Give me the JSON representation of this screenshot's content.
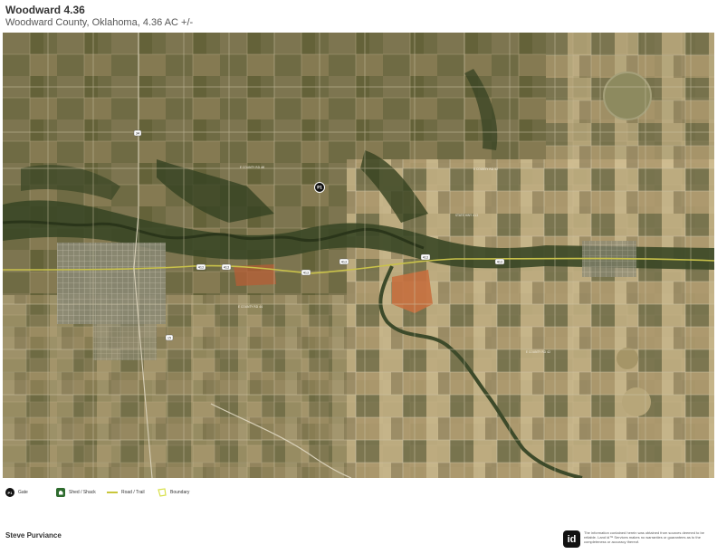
{
  "header": {
    "title": "Woodward 4.36",
    "subtitle": "Woodward County, Oklahoma, 4.36 AC +/-"
  },
  "map": {
    "marker_label": "P1",
    "highway_shields": [
      "412",
      "412",
      "412",
      "412",
      "412",
      "412",
      "34",
      "15"
    ],
    "road_labels": [
      "E COUNTY RD 46",
      "E COUNTY RD 44",
      "E COUNTY RD 42",
      "E COUNTY RD 52",
      "STATE HWY 412"
    ]
  },
  "scalebar": {
    "labels": [
      "0",
      "5000",
      "10000",
      "15000",
      "20000ft"
    ]
  },
  "legend": {
    "items": [
      {
        "label": "Gate",
        "icon": "gate-icon"
      },
      {
        "label": "Shed / Shack",
        "icon": "shed-icon"
      },
      {
        "label": "Road / Trail",
        "icon": "road-trail-icon"
      },
      {
        "label": "Boundary",
        "icon": "boundary-icon"
      }
    ]
  },
  "footer": {
    "owner": "Steve Purviance",
    "logo_text": "id",
    "disclaimer": "The information contained herein was obtained from sources deemed to be reliable. Land id™ Services makes no warranties or guarantees as to the completeness or accuracy thereof."
  },
  "colors": {
    "river": "#2f3b1f",
    "highway": "#c9c24a",
    "road": "#d8d0b8",
    "field_light": "#c5b07e",
    "field_green": "#5f6a3a",
    "orange_field": "#c6703f"
  }
}
